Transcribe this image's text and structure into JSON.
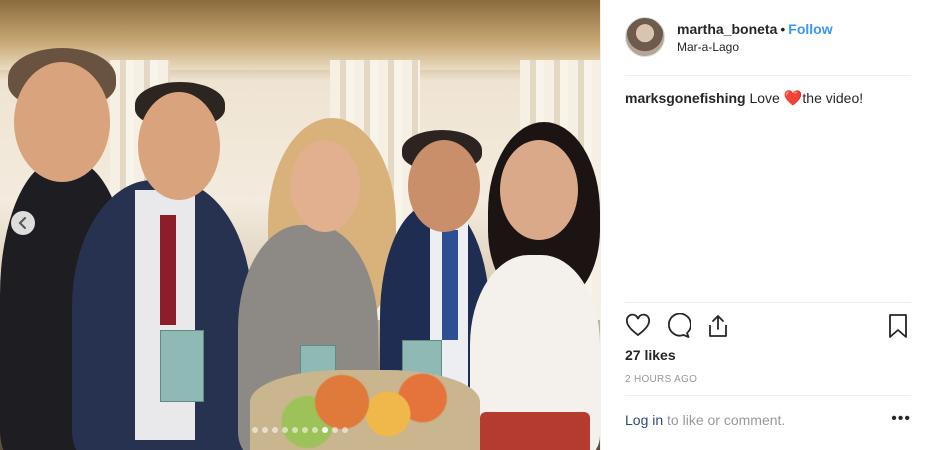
{
  "post": {
    "photo": {
      "alt_icon": "chevron-left-icon",
      "carousel_count": 10,
      "carousel_active": 7
    },
    "header": {
      "username": "martha_boneta",
      "separator": "•",
      "follow_label": "Follow",
      "location": "Mar-a-Lago"
    },
    "comments": [
      {
        "user": "marksgonefishing",
        "text_before": "Love ",
        "emoji": "❤️",
        "text_after": "the video!"
      }
    ],
    "actions": {
      "like_icon": "heart-icon",
      "comment_icon": "comment-icon",
      "share_icon": "share-icon",
      "save_icon": "bookmark-icon"
    },
    "likes": "27 likes",
    "timestamp": "2 HOURS AGO",
    "login": {
      "link": "Log in",
      "text": " to like or comment."
    },
    "more_label": "•••"
  },
  "colors": {
    "accent": "#3897f0",
    "text": "#262626",
    "muted": "#999999",
    "divider": "#efefef"
  }
}
